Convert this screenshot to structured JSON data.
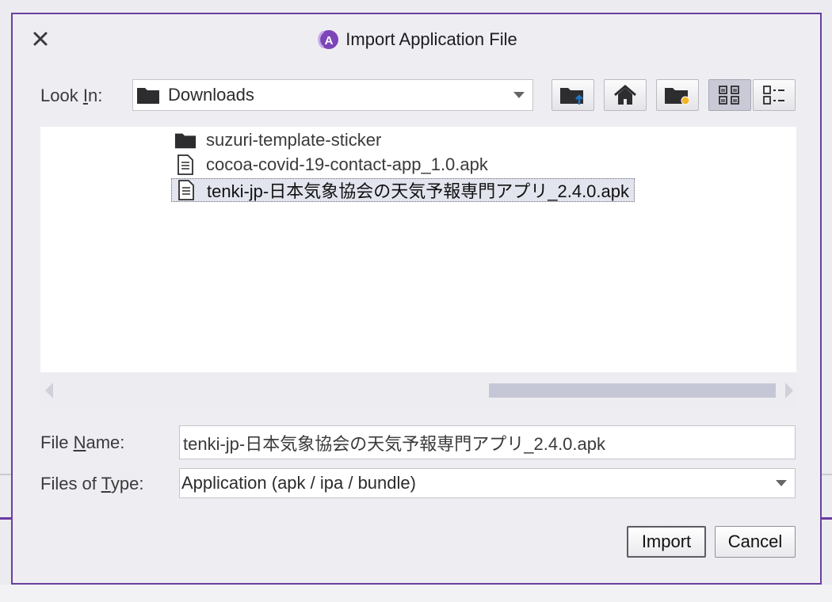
{
  "dialog": {
    "title": "Import Application File",
    "logo_letter": "A",
    "accent_color": "#6b3fa0"
  },
  "look_in": {
    "label_pre": "Look ",
    "label_mnemonic": "I",
    "label_post": "n:",
    "selected": "Downloads",
    "icon": "folder-icon"
  },
  "toolbar": {
    "buttons": [
      {
        "name": "up-one-level",
        "icon": "folder-up-icon"
      },
      {
        "name": "home",
        "icon": "home-icon"
      },
      {
        "name": "new-folder",
        "icon": "new-folder-icon"
      },
      {
        "name": "list-view",
        "icon": "list-view-icon",
        "active": true
      },
      {
        "name": "details-view",
        "icon": "details-view-icon"
      }
    ]
  },
  "files": [
    {
      "name": "suzuri-template-sticker",
      "type": "folder"
    },
    {
      "name": "cocoa-covid-19-contact-app_1.0.apk",
      "type": "file"
    },
    {
      "name": "tenki-jp-日本気象協会の天気予報専門アプリ_2.4.0.apk",
      "type": "file",
      "selected": true
    }
  ],
  "file_name": {
    "label_pre": "File ",
    "label_mnemonic": "N",
    "label_post": "ame:",
    "value": "tenki-jp-日本気象協会の天気予報専門アプリ_2.4.0.apk"
  },
  "file_type": {
    "label_pre": "Files of ",
    "label_mnemonic": "T",
    "label_post": "ype:",
    "selected": "Application (apk / ipa / bundle)"
  },
  "buttons": {
    "import": "Import",
    "cancel": "Cancel"
  }
}
